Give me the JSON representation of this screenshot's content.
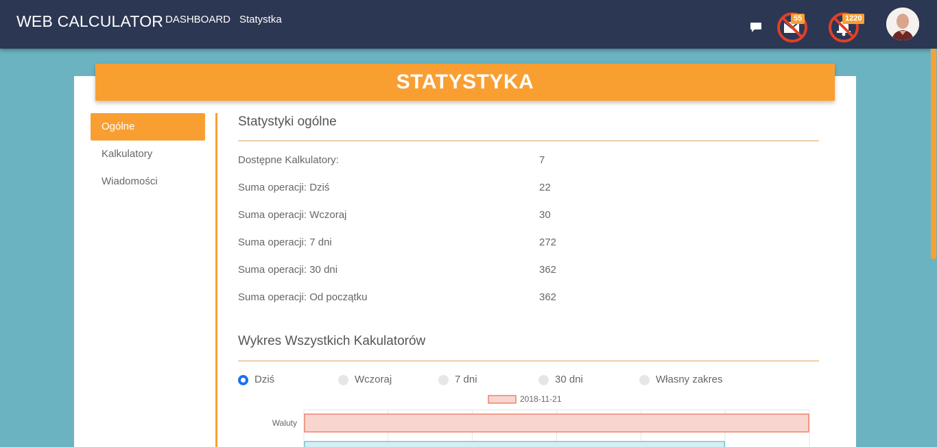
{
  "navbar": {
    "brand": "WEB CALCULATOR",
    "links": [
      "DASHBOARD",
      "Statystka"
    ],
    "mail_badge": "55",
    "bell_badge": "1220"
  },
  "banner": {
    "title": "STATYSTYKA"
  },
  "sidebar": {
    "items": [
      {
        "label": "Ogólne",
        "active": true
      },
      {
        "label": "Kalkulatory",
        "active": false
      },
      {
        "label": "Wiadomości",
        "active": false
      }
    ]
  },
  "general": {
    "title": "Statystyki ogólne",
    "rows": [
      {
        "label": "Dostępne Kalkulatory:",
        "value": "7"
      },
      {
        "label": "Suma operacji: Dziś",
        "value": "22"
      },
      {
        "label": "Suma operacji: Wczoraj",
        "value": "30"
      },
      {
        "label": "Suma operacji: 7 dni",
        "value": "272"
      },
      {
        "label": "Suma operacji: 30 dni",
        "value": "362"
      },
      {
        "label": "Suma operacji: Od początku",
        "value": "362"
      }
    ]
  },
  "chart_section": {
    "title": "Wykres Wszystkich Kakulatorów",
    "ranges": [
      "Dziś",
      "Wczoraj",
      "7 dni",
      "30 dni",
      "Własny zakres"
    ],
    "selected_range": "Dziś"
  },
  "colors": {
    "navbar": "#2c3753",
    "accent": "#f99f32",
    "background": "#6bb3c1",
    "radio_checked": "#1b6ff5"
  },
  "chart_data": {
    "type": "bar",
    "orientation": "horizontal",
    "categories": [
      "Waluty",
      ""
    ],
    "series": [
      {
        "name": "2018-11-21",
        "values": [
          6,
          5
        ]
      }
    ],
    "xlim": [
      0,
      6
    ],
    "legend": "top",
    "grid": true
  }
}
